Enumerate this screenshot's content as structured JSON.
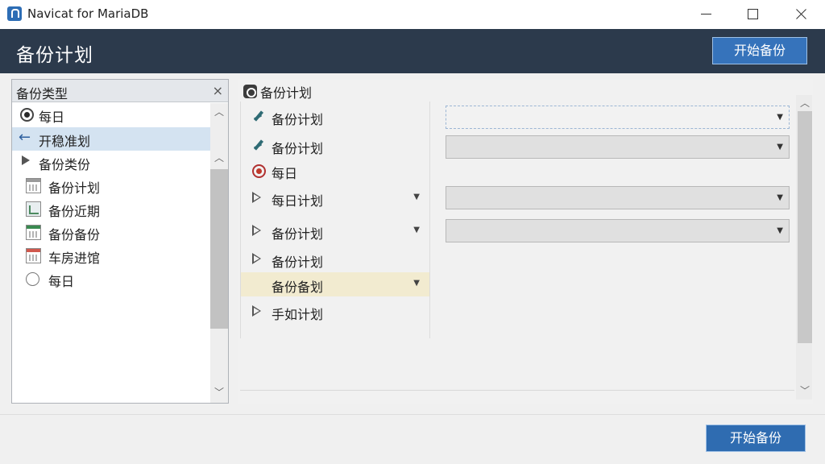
{
  "window": {
    "title": "Navicat for MariaDB"
  },
  "header": {
    "title": "备份计划",
    "start_button": "开始备份"
  },
  "left_panel": {
    "title": "备份类型",
    "close_glyph": "×",
    "items": [
      {
        "label": "每日",
        "icon": "radio-selected-icon"
      },
      {
        "label": "开稳准划",
        "icon": "back-arrow-icon"
      },
      {
        "label": "备份类份",
        "icon": "expand-triangle-icon"
      },
      {
        "label": "备份计划",
        "icon": "calendar-icon"
      },
      {
        "label": "备份近期",
        "icon": "chart-icon"
      },
      {
        "label": "备份备份",
        "icon": "calendar-grid-icon"
      },
      {
        "label": "车房进馆",
        "icon": "calendar-red-icon"
      },
      {
        "label": "每日",
        "icon": "radio-empty-icon"
      }
    ]
  },
  "right_panel": {
    "title": "备份计划",
    "rows": [
      {
        "label": "备份计划",
        "icon": "pin-icon"
      },
      {
        "label": "备份计划",
        "icon": "pin-icon"
      },
      {
        "label": "每日",
        "icon": "radio-red-icon"
      },
      {
        "label": "每日计划",
        "icon": "play-outline-icon"
      },
      {
        "label": "备份计划",
        "icon": "play-outline-icon"
      },
      {
        "label": "备份计划",
        "icon": "play-outline-icon"
      },
      {
        "label": "备份备划",
        "icon": "none"
      },
      {
        "label": "手如计划",
        "icon": "play-outline-icon"
      }
    ],
    "dropdowns": [
      {
        "value": ""
      },
      {
        "value": ""
      },
      {
        "value": ""
      },
      {
        "value": ""
      }
    ]
  },
  "footer": {
    "start_button": "开始备份"
  },
  "colors": {
    "header_bg": "#2c3a4c",
    "primary_button": "#3673bb",
    "selected_row": "#d4e3f1",
    "highlight_row": "#f2ebd0",
    "radio_red": "#c0392b"
  }
}
